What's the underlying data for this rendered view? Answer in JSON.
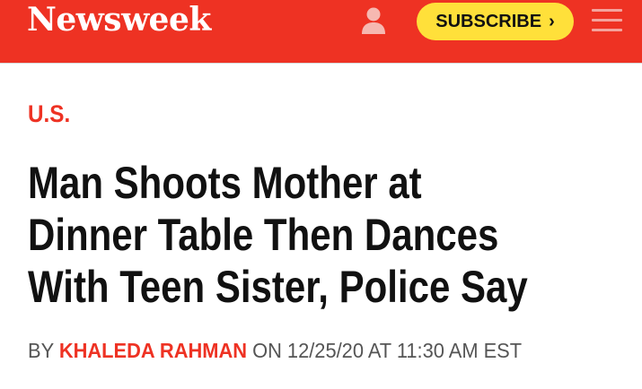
{
  "header": {
    "logo": "Newsweek",
    "subscribe_label": "SUBSCRIBE",
    "subscribe_chevron": "›",
    "icons": {
      "account": "account-icon",
      "menu": "menu-icon"
    },
    "colors": {
      "brand_red": "#ee3223",
      "subscribe_yellow": "#ffe03a"
    }
  },
  "article": {
    "section": "U.S.",
    "headline_lines": [
      "Man Shoots Mother at",
      "Dinner Table Then Dances",
      "With Teen Sister, Police Say"
    ],
    "byline": {
      "by": "BY",
      "author": "KHALEDA RAHMAN",
      "on": "ON",
      "date": "12/25/20",
      "at": "AT",
      "time": "11:30 AM EST"
    }
  }
}
